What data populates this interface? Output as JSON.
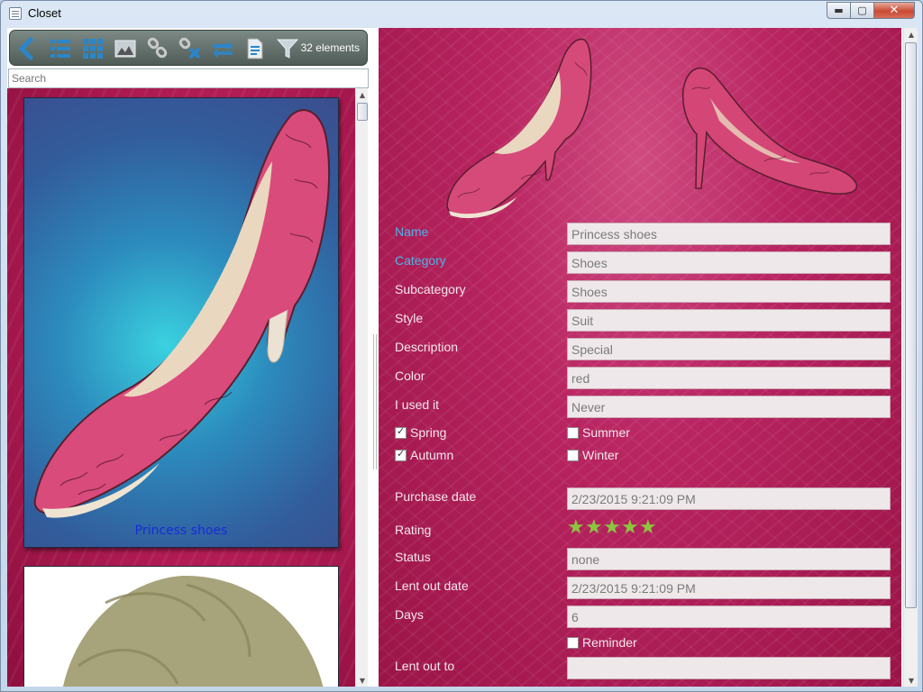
{
  "window": {
    "title": "Closet",
    "minimize_label": "▬",
    "maximize_label": "▢",
    "close_label": "✕"
  },
  "toolbar": {
    "icons": [
      "back-arrow-icon",
      "list-view-icon",
      "grid-view-icon",
      "image-view-icon",
      "link-icon",
      "unlink-icon",
      "swap-icon",
      "document-icon",
      "filter-icon"
    ],
    "count_label": "32 elements"
  },
  "search": {
    "placeholder": "Search"
  },
  "list": {
    "items": [
      {
        "title": "Princess shoes"
      },
      {
        "title": ""
      }
    ]
  },
  "form": {
    "name_label": "Name",
    "name_value": "Princess shoes",
    "category_label": "Category",
    "category_value": "Shoes",
    "subcategory_label": "Subcategory",
    "subcategory_value": "Shoes",
    "style_label": "Style",
    "style_value": "Suit",
    "description_label": "Description",
    "description_value": "Special",
    "color_label": "Color",
    "color_value": "red",
    "used_label": "I used it",
    "used_value": "Never",
    "seasons": {
      "spring": {
        "label": "Spring",
        "checked": true
      },
      "summer": {
        "label": "Summer",
        "checked": false
      },
      "autumn": {
        "label": "Autumn",
        "checked": true
      },
      "winter": {
        "label": "Winter",
        "checked": false
      }
    },
    "purchase_label": "Purchase date",
    "purchase_value": "2/23/2015 9:21:09 PM",
    "rating_label": "Rating",
    "rating_value": 5,
    "rating_max": 5,
    "status_label": "Status",
    "status_value": "none",
    "lent_date_label": "Lent out date",
    "lent_date_value": "2/23/2015 9:21:09 PM",
    "days_label": "Days",
    "days_value": "6",
    "reminder": {
      "label": "Reminder",
      "checked": false
    },
    "lent_to_label": "Lent out to",
    "lent_to_value": ""
  },
  "colors": {
    "accent_label": "#4fb3e6",
    "star": "#8cc63f",
    "background_pink": "#b82460"
  }
}
